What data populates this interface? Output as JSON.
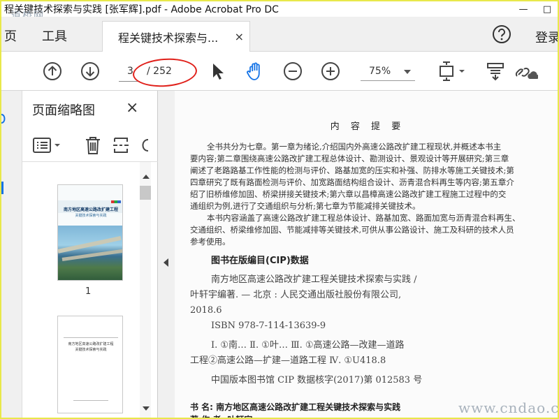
{
  "window": {
    "title": "程关键技术探索与实践 [张军辉].pdf - Adobe Acrobat Pro DC",
    "watermark_top": "道桥网",
    "minimize": "—",
    "maximize": "□"
  },
  "tabs": {
    "home_partial": "页",
    "tools": "工具",
    "doc_tab_label": "程关键技术探索与...",
    "doc_tab_close": "×",
    "login": "登录"
  },
  "toolbar": {
    "current_page": "3",
    "total_pages": "/ 252",
    "zoom": "75%"
  },
  "panel": {
    "title": "页面缩略图",
    "close": "×",
    "thumb1_title": "南方地区高速公路改扩建工程",
    "thumb1_subtitle": "关键技术探索与实践",
    "thumb1_page": "1",
    "thumb2_lines": [
      "南方地区高速公路改扩建工程",
      "关键技术探索与实践"
    ]
  },
  "document": {
    "summary_heading": "内 容 提 要",
    "summary_para1": [
      "全书共分为七章。第一章为绪论,介绍国内外高速公路改扩建工程现状,并概述本书主",
      "要内容;第二章围绕高速公路改扩建工程总体设计、勘测设计、景观设计等开展研究;第三章",
      "阐述了老路路基工作性能的检测与评价、路基加宽的压实和补强、防排水等施工关键技术;第",
      "四章研究了既有路面检测与评价、加宽路面结构组合设计、沥青混合料再生等内容;第五章介",
      "绍了旧桥维修加固、桥梁拼接关键技术;第六章以昌樟高速公路改扩建工程施工过程中的交",
      "通组织为例,进行了交通组织与分析;第七章为节能减排关键技术。"
    ],
    "summary_para2": [
      "本书内容涵盖了高速公路改扩建工程总体设计、路基加宽、路面加宽与沥青混合料再生、",
      "交通组织、桥梁维修加固、节能减排等关键技术,可供从事公路设计、施工及科研的技术人员",
      "参考使用。"
    ],
    "cip_heading": "图书在版编目(CIP)数据",
    "cip_lines": [
      "南方地区高速公路改扩建工程关键技术探索与实践 /",
      "叶轩宇编著. — 北京 : 人民交通出版社股份有限公司,",
      "2018.6",
      "ISBN 978-7-114-13639-9",
      "Ⅰ. ①南… Ⅱ. ①叶… Ⅲ. ①高速公路—改建—道路",
      "工程②高速公路—扩建—道路工程 Ⅳ. ①U418.8",
      "中国版本图书馆 CIP 数据核字(2017)第 012583 号"
    ],
    "book_label": "书   名: 南方地区高速公路改扩建工程关键技术探索与实践",
    "author_label": "著 作 者: 叶轩宇"
  },
  "watermark_bottom": "www.cndao.com",
  "colors": {
    "accent": "#1473e6",
    "annotation_red": "#e0201a",
    "frame_yellow": "#e8e84a"
  }
}
